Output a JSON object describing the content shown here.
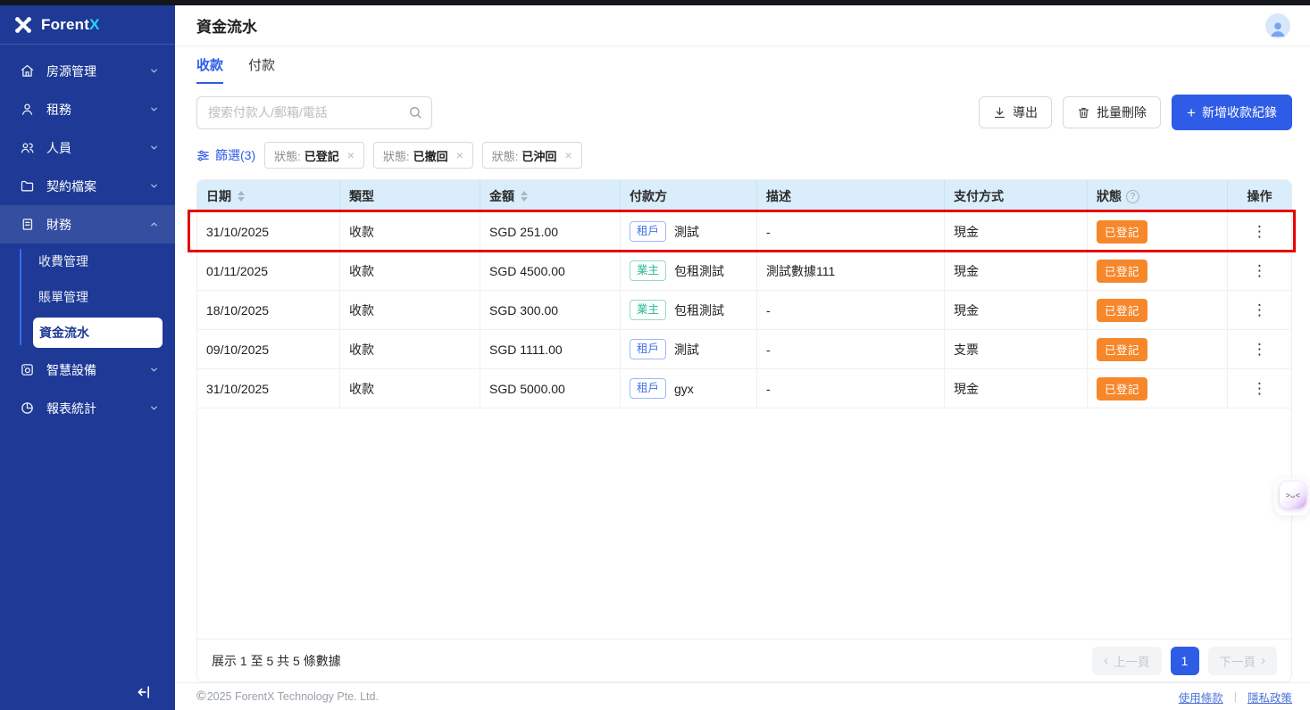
{
  "sidebar": {
    "logo": {
      "brand": "Forent",
      "accent": "X"
    },
    "items": [
      {
        "label": "房源管理",
        "icon": "home-icon"
      },
      {
        "label": "租務",
        "icon": "person-icon"
      },
      {
        "label": "人員",
        "icon": "people-icon"
      },
      {
        "label": "契約檔案",
        "icon": "folder-icon"
      },
      {
        "label": "財務",
        "icon": "finance-icon",
        "expanded": true
      },
      {
        "label": "智慧設備",
        "icon": "device-icon"
      },
      {
        "label": "報表統計",
        "icon": "chart-icon"
      }
    ],
    "finance_submenu": [
      {
        "label": "收費管理"
      },
      {
        "label": "賬單管理"
      },
      {
        "label": "資金流水",
        "active": true
      }
    ]
  },
  "header": {
    "title": "資金流水"
  },
  "tabs": [
    {
      "label": "收款",
      "active": true
    },
    {
      "label": "付款",
      "active": false
    }
  ],
  "toolbar": {
    "search_placeholder": "搜索付款人/郵箱/電話",
    "export_label": "導出",
    "batch_delete_label": "批量刪除",
    "add_label": "新增收款紀錄"
  },
  "filters": {
    "trigger_label": "篩選(3)",
    "chips": [
      {
        "label": "狀態:",
        "value": "已登記"
      },
      {
        "label": "狀態:",
        "value": "已撤回"
      },
      {
        "label": "狀態:",
        "value": "已沖回"
      }
    ]
  },
  "table": {
    "columns": [
      "日期",
      "類型",
      "金額",
      "付款方",
      "描述",
      "支付方式",
      "狀態",
      "操作"
    ],
    "rows": [
      {
        "date": "31/10/2025",
        "type": "收款",
        "amount": "SGD 251.00",
        "payer_tag": "租戶",
        "payer": "測試",
        "desc": "-",
        "method": "現金",
        "status": "已登記",
        "highlighted": true
      },
      {
        "date": "01/11/2025",
        "type": "收款",
        "amount": "SGD 4500.00",
        "payer_tag": "業主",
        "payer": "包租測試",
        "desc": "測試數據111",
        "method": "現金",
        "status": "已登記",
        "highlighted": false
      },
      {
        "date": "18/10/2025",
        "type": "收款",
        "amount": "SGD 300.00",
        "payer_tag": "業主",
        "payer": "包租測試",
        "desc": "-",
        "method": "現金",
        "status": "已登記",
        "highlighted": false
      },
      {
        "date": "09/10/2025",
        "type": "收款",
        "amount": "SGD 1111.00",
        "payer_tag": "租戶",
        "payer": "測試",
        "desc": "-",
        "method": "支票",
        "status": "已登記",
        "highlighted": false
      },
      {
        "date": "31/10/2025",
        "type": "收款",
        "amount": "SGD 5000.00",
        "payer_tag": "租戶",
        "payer": "gyx",
        "desc": "-",
        "method": "現金",
        "status": "已登記",
        "highlighted": false
      }
    ]
  },
  "pagination": {
    "summary": "展示 1 至 5 共 5 條數據",
    "prev_label": "上一頁",
    "current_page": "1",
    "next_label": "下一頁"
  },
  "footer": {
    "copyright_symbol": "©",
    "copyright_text": "2025 ForentX Technology Pte. Ltd.",
    "terms_label": "使用條款",
    "privacy_label": "隱私政策"
  },
  "icons": {
    "close": "×",
    "more": "⋮",
    "prev_chevron": "‹",
    "next_chevron": "›",
    "plus": "+",
    "help": "?",
    "assistant_face": "&gt;ᴗ&lt;"
  },
  "assistant": {
    "face": ">ᴗ<"
  },
  "colors": {
    "sidebar_bg": "#1e3a96",
    "accent_blue": "#2e5ce6",
    "brand_accent_cyan": "#2bd2f5",
    "table_header_bg": "#d9edfa",
    "status_badge_orange": "#f6872b",
    "tenant_tag_blue": "#4272e6",
    "landlord_tag_teal": "#26b795",
    "highlight_red": "#e60000"
  }
}
